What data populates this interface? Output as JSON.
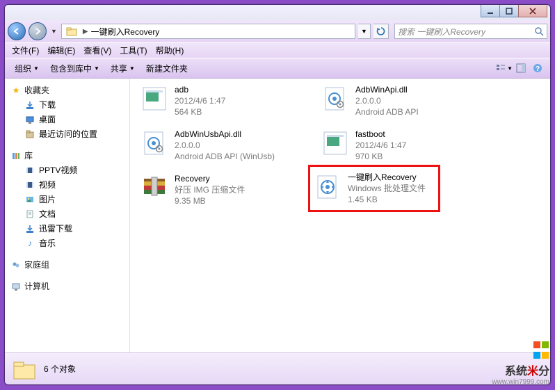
{
  "window": {
    "min_tip": "最小化",
    "max_tip": "最大化",
    "close_tip": "关闭"
  },
  "nav": {
    "folder_name": "一键刷入Recovery",
    "search_placeholder": "搜索 一键刷入Recovery"
  },
  "menu": {
    "file": "文件(F)",
    "edit": "编辑(E)",
    "view": "查看(V)",
    "tools": "工具(T)",
    "help": "帮助(H)"
  },
  "toolbar": {
    "organize": "组织",
    "include": "包含到库中",
    "share": "共享",
    "newfolder": "新建文件夹"
  },
  "tree": {
    "favorites": "收藏夹",
    "downloads": "下载",
    "desktop": "桌面",
    "recent": "最近访问的位置",
    "libraries": "库",
    "pptv": "PPTV视频",
    "videos": "视频",
    "pictures": "图片",
    "documents": "文档",
    "xunlei": "迅雷下载",
    "music": "音乐",
    "homegroup": "家庭组",
    "computer": "计算机"
  },
  "files": [
    {
      "name": "adb",
      "line2": "2012/4/6 1:47",
      "line3": "564 KB",
      "type": "exe"
    },
    {
      "name": "AdbWinApi.dll",
      "line2": "2.0.0.0",
      "line3": "Android ADB API",
      "type": "dll"
    },
    {
      "name": "AdbWinUsbApi.dll",
      "line2": "2.0.0.0",
      "line3": "Android ADB API (WinUsb)",
      "type": "dll"
    },
    {
      "name": "fastboot",
      "line2": "2012/4/6 1:47",
      "line3": "970 KB",
      "type": "exe"
    },
    {
      "name": "Recovery",
      "line2": "好压 IMG 压缩文件",
      "line3": "9.35 MB",
      "type": "archive"
    },
    {
      "name": "一键刷入Recovery",
      "line2": "Windows 批处理文件",
      "line3": "1.45 KB",
      "type": "bat",
      "highlighted": true
    }
  ],
  "status": {
    "count_label": "6 个对象"
  },
  "watermark": {
    "brand": "系统",
    "suffix": "分",
    "url": "www.win7999.com"
  }
}
